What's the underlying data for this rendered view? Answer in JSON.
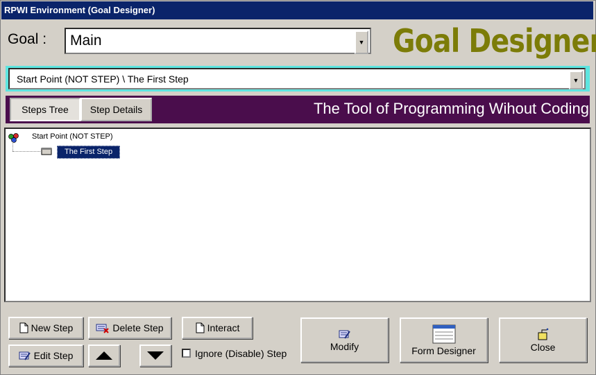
{
  "window": {
    "title": "RPWI Environment (Goal Designer)"
  },
  "goal": {
    "label": "Goal :",
    "value": "Main"
  },
  "brand": {
    "heading": "Goal Designer",
    "tagline": "The Tool of Programming Wihout Coding",
    "accent": "#7c7c08"
  },
  "path": {
    "value": "Start Point (NOT STEP)  \\  The First Step"
  },
  "tabs": [
    {
      "label": "Steps Tree",
      "active": true
    },
    {
      "label": "Step Details",
      "active": false
    }
  ],
  "tree": {
    "root": {
      "label": "Start Point (NOT STEP)",
      "icon": "start-point-icon"
    },
    "children": [
      {
        "label": "The First Step",
        "selected": true,
        "icon": "step-icon"
      }
    ]
  },
  "buttons": {
    "new_step": "New Step",
    "delete_step": "Delete Step",
    "interact": "Interact",
    "edit_step": "Edit Step",
    "ignore_step": "Ignore (Disable) Step",
    "modify": "Modify",
    "form_designer": "Form Designer",
    "close": "Close"
  },
  "colors": {
    "titlebar": "#0a246a",
    "cyan_frame": "#5de5e0",
    "purple_band": "#4a0d4c",
    "selection": "#0a246a"
  }
}
